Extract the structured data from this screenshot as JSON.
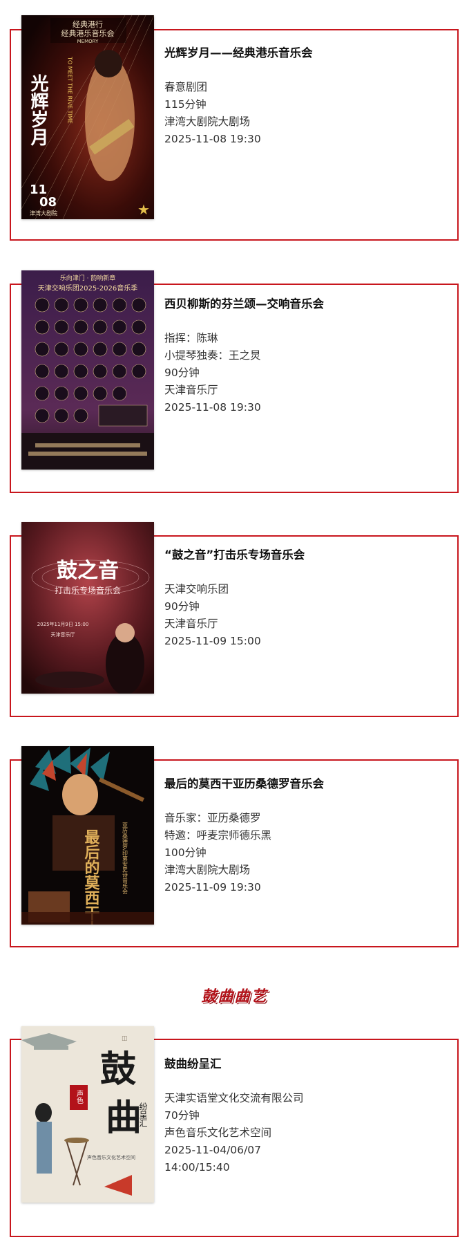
{
  "events": [
    {
      "title": "光辉岁月——经典港乐音乐会",
      "details": [
        "春意剧团",
        "115分钟",
        "津湾大剧院大剧场",
        "2025-11-08 19:30"
      ],
      "poster": {
        "header": "经典港乐音乐会",
        "top_line": "经典港行",
        "sub": "MEMORY",
        "main": "光辉岁月",
        "side": "TO MEET THE RIVE TIME",
        "date_top": "11",
        "date_bottom": "08",
        "venue": "津湾大剧院"
      }
    },
    {
      "title": "西贝柳斯的芬兰颂—交响音乐会",
      "details": [
        "指挥：陈琳",
        "小提琴独奏：王之炅",
        "90分钟",
        "天津音乐厅",
        "2025-11-08 19:30"
      ],
      "poster": {
        "top_line": "乐向津门 · 韵响新章",
        "main": "天津交响乐团2025-2026音乐季"
      }
    },
    {
      "title": "“鼓之音”打击乐专场音乐会",
      "details": [
        "天津交响乐团",
        "90分钟",
        "天津音乐厅",
        "2025-11-09 15:00"
      ],
      "poster": {
        "main": "鼓之音",
        "sub": "打击乐专场音乐会",
        "date": "2025年11月9日 15:00",
        "venue": "天津音乐厅"
      }
    },
    {
      "title": "最后的莫西干亚历桑德罗音乐会",
      "details": [
        "音乐家：亚历桑德罗",
        "特邀：呼麦宗师德乐黑",
        "100分钟",
        "津湾大剧院大剧场",
        "2025-11-09 19:30"
      ],
      "poster": {
        "main": "最后的莫西干人",
        "sub": "亚历桑德罗印第安史诗音乐会"
      }
    }
  ],
  "section_heading": "鼓曲曲艺",
  "quyi_event": {
    "title": "鼓曲纷呈汇",
    "details": [
      "天津实语堂文化交流有限公司",
      "70分钟",
      "声色音乐文化艺术空间",
      "2025-11-04/06/07",
      "14:00/15:40"
    ],
    "poster": {
      "main_1": "鼓",
      "main_2": "曲",
      "seal": "声色",
      "side": "纷呈汇",
      "venue": "声色音乐文化艺术空间"
    }
  },
  "colors": {
    "accent": "#c8161d",
    "heading": "#b3121a"
  }
}
